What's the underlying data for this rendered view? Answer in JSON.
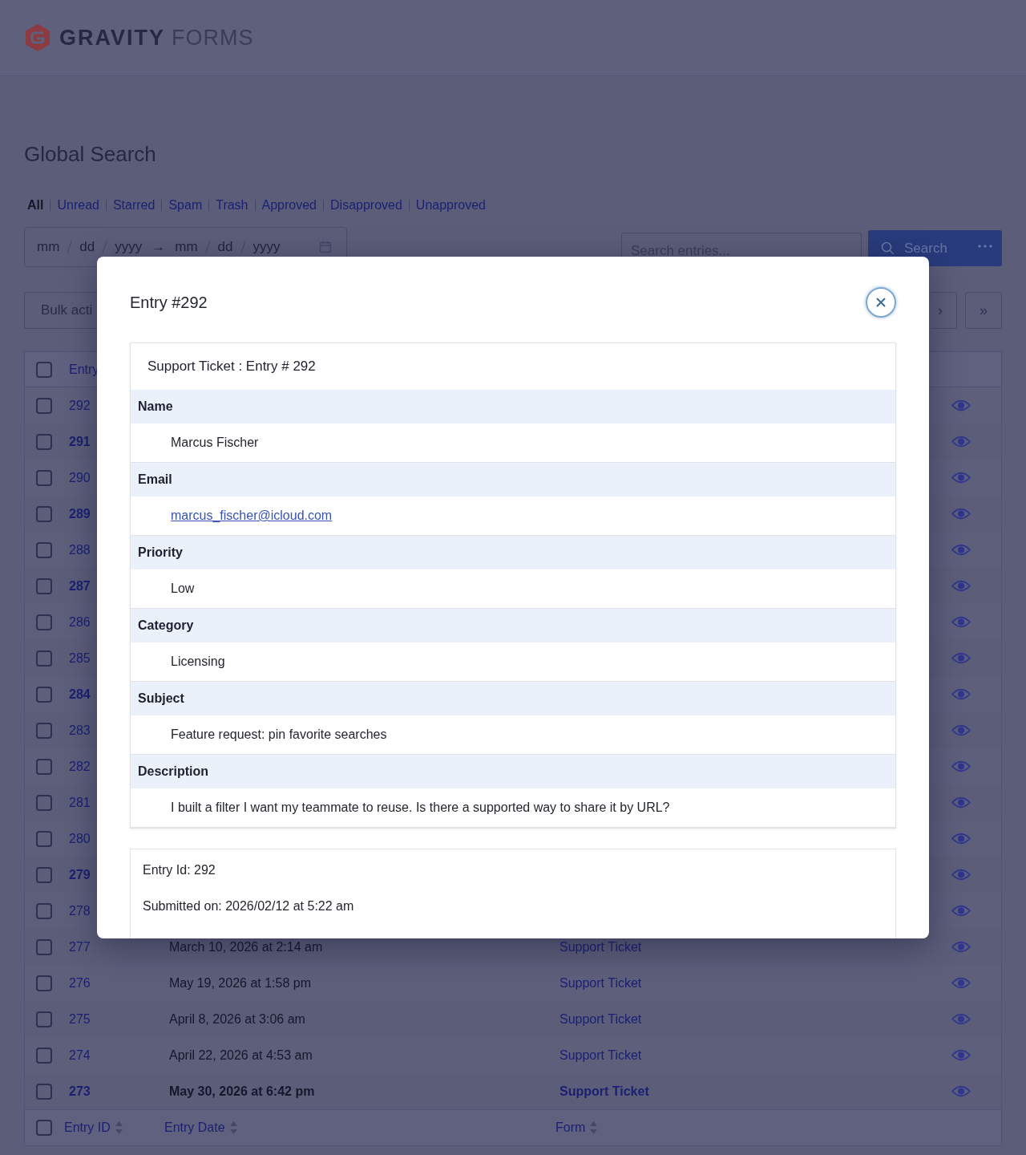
{
  "brand": {
    "word_1": "GRAVITY",
    "word_2": "FORMS"
  },
  "page_title": "Global Search",
  "filters": [
    {
      "label": "All",
      "selected": true
    },
    {
      "label": "Unread",
      "selected": false
    },
    {
      "label": "Starred",
      "selected": false
    },
    {
      "label": "Spam",
      "selected": false
    },
    {
      "label": "Trash",
      "selected": false
    },
    {
      "label": "Approved",
      "selected": false
    },
    {
      "label": "Disapproved",
      "selected": false
    },
    {
      "label": "Unapproved",
      "selected": false
    }
  ],
  "date_range": {
    "start": [
      "mm",
      "dd",
      "yyyy"
    ],
    "arrow": "→",
    "end": [
      "mm",
      "dd",
      "yyyy"
    ]
  },
  "search": {
    "placeholder": "Search entries...",
    "button": "Search"
  },
  "bulk_action": "Bulk acti",
  "pagination": [
    "›",
    "»"
  ],
  "table": {
    "header_checked": false,
    "footer_checked": false,
    "header_column": "Entry",
    "footer_columns": [
      "Entry ID",
      "Entry Date",
      "Form"
    ],
    "rows": [
      {
        "id": "292",
        "unread": false,
        "checked": false
      },
      {
        "id": "291",
        "unread": true,
        "checked": false
      },
      {
        "id": "290",
        "unread": false,
        "checked": false
      },
      {
        "id": "289",
        "unread": true,
        "checked": false
      },
      {
        "id": "288",
        "unread": false,
        "checked": false
      },
      {
        "id": "287",
        "unread": true,
        "checked": false
      },
      {
        "id": "286",
        "unread": false,
        "checked": false
      },
      {
        "id": "285",
        "unread": false,
        "checked": false
      },
      {
        "id": "284",
        "unread": true,
        "checked": false
      },
      {
        "id": "283",
        "unread": false,
        "checked": false
      },
      {
        "id": "282",
        "unread": false,
        "checked": false
      },
      {
        "id": "281",
        "unread": false,
        "checked": false
      },
      {
        "id": "280",
        "unread": false,
        "checked": false
      },
      {
        "id": "279",
        "unread": true,
        "checked": false
      },
      {
        "id": "278",
        "unread": false,
        "checked": false
      },
      {
        "id": "277",
        "unread": false,
        "checked": false,
        "date": "March 10, 2026 at 2:14 am",
        "form": "Support Ticket"
      },
      {
        "id": "276",
        "unread": false,
        "checked": false,
        "date": "May 19, 2026 at 1:58 pm",
        "form": "Support Ticket"
      },
      {
        "id": "275",
        "unread": false,
        "checked": false,
        "date": "April 8, 2026 at 3:06 am",
        "form": "Support Ticket"
      },
      {
        "id": "274",
        "unread": false,
        "checked": false,
        "date": "April 22, 2026 at 4:53 am",
        "form": "Support Ticket"
      },
      {
        "id": "273",
        "unread": true,
        "checked": false,
        "date": "May 30, 2026 at 6:42 pm",
        "form": "Support Ticket"
      }
    ]
  },
  "modal": {
    "title": "Entry #292",
    "panel_title": "Support Ticket : Entry # 292",
    "fields": [
      {
        "label": "Name",
        "value": "Marcus Fischer",
        "kind": "text"
      },
      {
        "label": "Email",
        "value": "marcus_fischer@icloud.com",
        "kind": "link"
      },
      {
        "label": "Priority",
        "value": "Low",
        "kind": "text"
      },
      {
        "label": "Category",
        "value": "Licensing",
        "kind": "text"
      },
      {
        "label": "Subject",
        "value": "Feature request: pin favorite searches",
        "kind": "text"
      },
      {
        "label": "Description",
        "value": "I built a filter I want my teammate to reuse. Is there a supported way to share it by URL?",
        "kind": "text"
      }
    ],
    "meta": [
      "Entry Id: 292",
      "Submitted on: 2026/02/12 at 5:22 am"
    ]
  }
}
